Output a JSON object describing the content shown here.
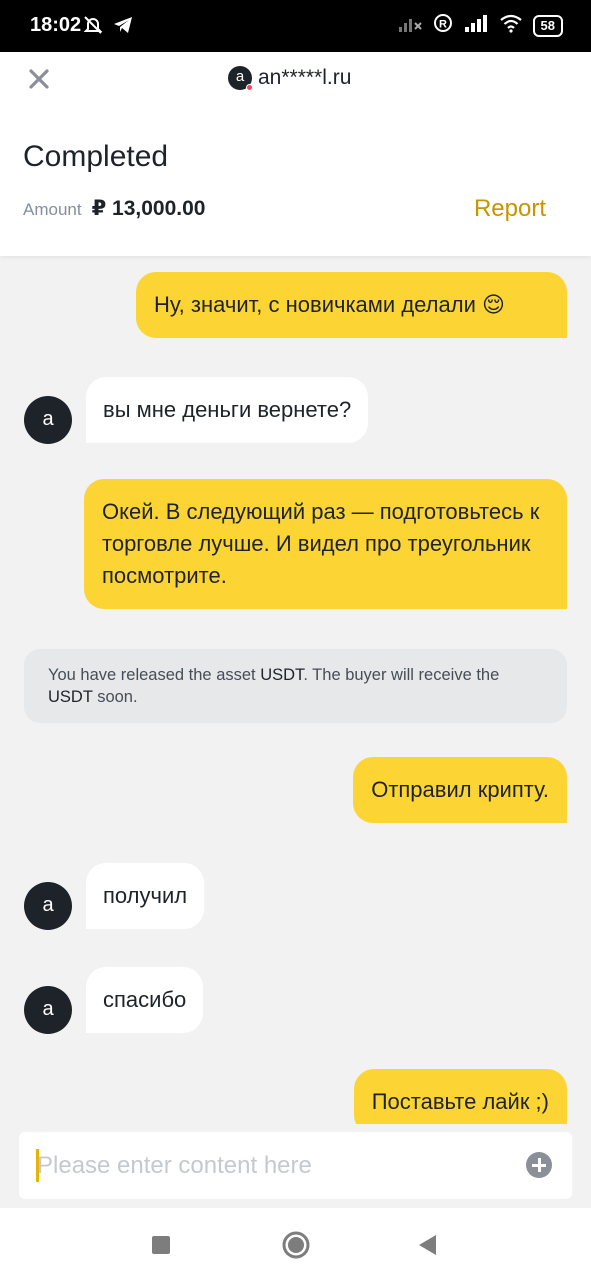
{
  "status_bar": {
    "time": "18:02",
    "battery": "58",
    "icons": [
      "mute-icon",
      "telegram-icon",
      "signal-x-icon",
      "registered-icon",
      "signal-icon",
      "wifi-icon",
      "battery-icon"
    ]
  },
  "header": {
    "close_icon": "close-icon",
    "peer_initial": "a",
    "peer_name": "an*****l.ru",
    "status": "Completed",
    "amount_label": "Amount",
    "amount_value": "₽ 13,000.00",
    "report_label": "Report"
  },
  "messages": [
    {
      "side": "out",
      "text": "Ну, значит, с новичками делали 😌"
    },
    {
      "side": "in",
      "avatar": "a",
      "text": "вы мне деньги вернете?"
    },
    {
      "side": "out",
      "text": "Окей. В следующий раз — подготовьтесь к торговле лучше. И видел про треугольник посмотрите."
    },
    {
      "side": "system",
      "parts": [
        "You have released the asset ",
        "USDT",
        ". The buyer will receive the ",
        "USDT",
        " soon."
      ]
    },
    {
      "side": "out",
      "text": "Отправил крипту."
    },
    {
      "side": "in",
      "avatar": "a",
      "text": "получил"
    },
    {
      "side": "in",
      "avatar": "a",
      "text": "спасибо"
    },
    {
      "side": "out",
      "text": "Поставьте лайк ;)"
    }
  ],
  "input": {
    "placeholder": "Please enter content here",
    "value": "",
    "add_icon": "plus-circle-icon"
  },
  "nav": {
    "icons": [
      "recents-square-icon",
      "home-circle-icon",
      "back-triangle-icon"
    ]
  },
  "colors": {
    "accent": "#fcd535",
    "report": "#c99400",
    "dark": "#1e2329",
    "background": "#f2f2f2"
  }
}
